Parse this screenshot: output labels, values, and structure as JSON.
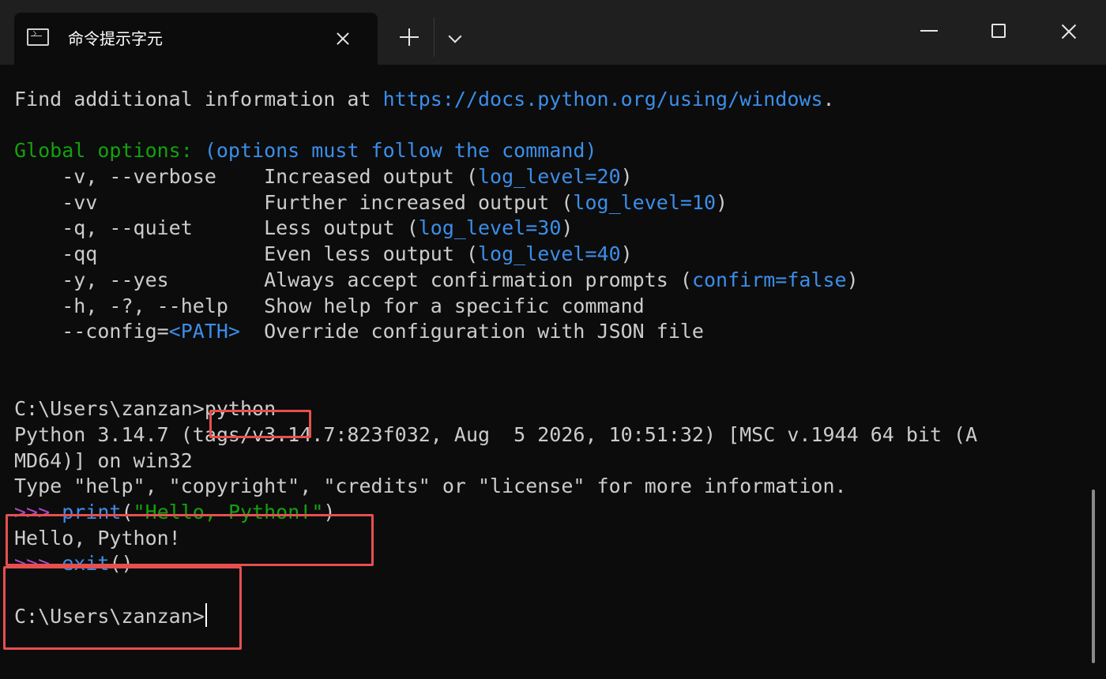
{
  "window": {
    "tab_title": "命令提示字元",
    "tab_icon": "cmd-icon"
  },
  "terminal": {
    "lines": [
      [
        {
          "text": "Find additional information at ",
          "c": "w"
        },
        {
          "text": "https://docs.python.org/using/windows",
          "c": "b"
        },
        {
          "text": ".",
          "c": "w"
        }
      ],
      [],
      [
        {
          "text": "Global options: ",
          "c": "g"
        },
        {
          "text": "(options must follow the command)",
          "c": "b"
        }
      ],
      [
        {
          "text": "    -v, --verbose    Increased output (",
          "c": "w"
        },
        {
          "text": "log_level=20",
          "c": "b"
        },
        {
          "text": ")",
          "c": "w"
        }
      ],
      [
        {
          "text": "    -vv              Further increased output (",
          "c": "w"
        },
        {
          "text": "log_level=10",
          "c": "b"
        },
        {
          "text": ")",
          "c": "w"
        }
      ],
      [
        {
          "text": "    -q, --quiet      Less output (",
          "c": "w"
        },
        {
          "text": "log_level=30",
          "c": "b"
        },
        {
          "text": ")",
          "c": "w"
        }
      ],
      [
        {
          "text": "    -qq              Even less output (",
          "c": "w"
        },
        {
          "text": "log_level=40",
          "c": "b"
        },
        {
          "text": ")",
          "c": "w"
        }
      ],
      [
        {
          "text": "    -y, --yes        Always accept confirmation prompts (",
          "c": "w"
        },
        {
          "text": "confirm=false",
          "c": "b"
        },
        {
          "text": ")",
          "c": "w"
        }
      ],
      [
        {
          "text": "    -h, -?, --help   Show help for a specific command",
          "c": "w"
        }
      ],
      [
        {
          "text": "    --config=",
          "c": "w"
        },
        {
          "text": "<PATH>",
          "c": "b"
        },
        {
          "text": "  Override configuration with JSON file",
          "c": "w"
        }
      ],
      [],
      [],
      [
        {
          "text": "C:\\Users\\zanzan>python",
          "c": "w"
        }
      ],
      [
        {
          "text": "Python 3.14.7 (tags/v3.14.7:823f032, Aug  5 2026, 10:51:32) [MSC v.1944 64 bit (A",
          "c": "w"
        }
      ],
      [
        {
          "text": "MD64)] on win32",
          "c": "w"
        }
      ],
      [
        {
          "text": "Type \"help\", \"copyright\", \"credits\" or \"license\" for more information.",
          "c": "w"
        }
      ],
      [
        {
          "text": ">>> ",
          "c": "m"
        },
        {
          "text": "print",
          "c": "b"
        },
        {
          "text": "(",
          "c": "w"
        },
        {
          "text": "\"Hello, Python!\"",
          "c": "g"
        },
        {
          "text": ")",
          "c": "w"
        }
      ],
      [
        {
          "text": "Hello, Python!",
          "c": "w"
        }
      ],
      [
        {
          "text": ">>> ",
          "c": "m"
        },
        {
          "text": "exit",
          "c": "b"
        },
        {
          "text": "()",
          "c": "w"
        }
      ],
      [],
      [
        {
          "text": "C:\\Users\\zanzan>",
          "c": "w",
          "cursor": true
        }
      ]
    ]
  },
  "colors": {
    "background": "#0c0c0c",
    "titlebar": "#1f1f1f",
    "green": "#13a10e",
    "blue": "#3b8eea",
    "magenta": "#b148c6",
    "highlight_box": "#e5504f"
  }
}
